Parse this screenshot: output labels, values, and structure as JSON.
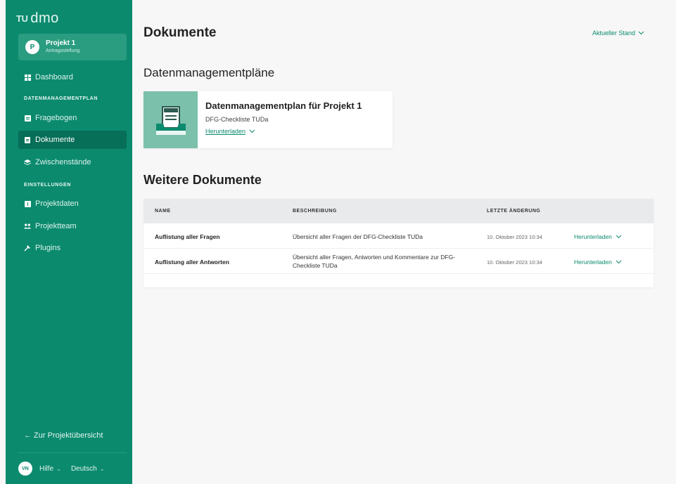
{
  "app": {
    "logo_prefix": "TU",
    "logo_name": "dmo"
  },
  "sidebar": {
    "project": {
      "initial": "P",
      "name": "Projekt 1",
      "status": "Antragsstellung"
    },
    "dashboard": "Dashboard",
    "section_dmp": "DATENMANAGEMENTPLAN",
    "items_dmp": [
      {
        "label": "Fragebogen",
        "icon": "questionnaire-icon"
      },
      {
        "label": "Dokumente",
        "icon": "document-icon",
        "active": true
      },
      {
        "label": "Zwischenstände",
        "icon": "layers-icon"
      }
    ],
    "section_settings": "EINSTELLUNGEN",
    "items_settings": [
      {
        "label": "Projektdaten",
        "icon": "project-data-icon"
      },
      {
        "label": "Projektteam",
        "icon": "team-icon"
      },
      {
        "label": "Plugins",
        "icon": "plugin-icon"
      }
    ],
    "back_link": "← Zur Projektübersicht",
    "footer": {
      "user_initials": "VN",
      "help": "Hilfe",
      "language": "Deutsch"
    }
  },
  "main": {
    "title": "Dokumente",
    "version_select": "Aktueller Stand",
    "dmp_heading": "Datenmanagementpläne",
    "dmp_card": {
      "title": "Datenmanagementplan für Projekt 1",
      "subtitle": "DFG-Checkliste TUDa",
      "download": "Herunterladen"
    },
    "more_heading": "Weitere Dokumente",
    "table": {
      "columns": [
        "NAME",
        "BESCHREIBUNG",
        "LETZTE ÄNDERUNG"
      ],
      "rows": [
        {
          "name": "Auflistung aller Fragen",
          "description": "Übersicht aller Fragen der DFG-Checkliste TUDa",
          "date": "10. Oktober 2023 10:34",
          "action": "Herunterladen"
        },
        {
          "name": "Auflistung aller Antworten",
          "description": "Übersicht aller Fragen, Antworten und Kommentare zur DFG-Checkliste TUDa",
          "date": "10. Oktober 2023 10:34",
          "action": "Herunterladen"
        }
      ]
    }
  },
  "colors": {
    "brand": "#0b8a6e",
    "sidebar_active": "#076e58",
    "thumb": "#7bc0ab"
  }
}
